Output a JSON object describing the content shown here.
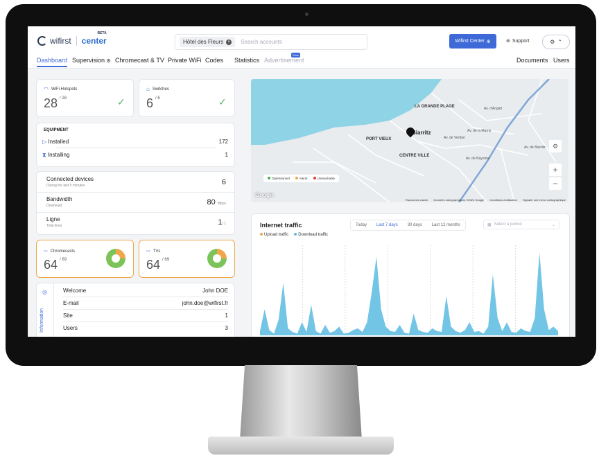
{
  "header": {
    "logo_brand": "wifirst",
    "logo_product": "center",
    "logo_beta": "BETA",
    "search_chip": "Hôtel des Fleurs",
    "search_placeholder": "Search accounts",
    "wifirst_center_button": "Wifirst Center",
    "support_label": "Support"
  },
  "nav": {
    "dashboard": "Dashboard",
    "supervision": "Supervision",
    "chromecast_tv": "Chromecast & TV",
    "private_wifi": "Private WiFi",
    "codes": "Codes",
    "statistics": "Statistics",
    "advertisement": "Advertisement",
    "soon_badge": "Soon",
    "documents": "Documents",
    "users": "Users"
  },
  "cards": {
    "wifi_hotspots": {
      "label": "WiFi Hotspots",
      "value": "28",
      "total": "/ 28"
    },
    "switches": {
      "label": "Switches",
      "value": "6",
      "total": "/ 6"
    },
    "equipment": {
      "title": "EQUIPMENT",
      "installed_label": "Installed",
      "installed_value": "172",
      "installing_label": "Installing",
      "installing_value": "1"
    },
    "connected_devices": {
      "label": "Connected devices",
      "sub": "During the last 5 minutes",
      "value": "6"
    },
    "bandwidth": {
      "label": "Bandwidth",
      "sub": "Download",
      "value": "80",
      "unit": "Mbps"
    },
    "ligne": {
      "label": "Ligne",
      "sub": "Total lines",
      "value": "1",
      "total": "/ 1"
    },
    "chromecasts": {
      "label": "Chromecasts",
      "value": "64",
      "total": "/ 69"
    },
    "tvs": {
      "label": "TVs",
      "value": "64",
      "total": "/ 69"
    },
    "information": {
      "side_label": "Information",
      "rows": [
        {
          "label": "Welcome",
          "value": "John DOE"
        },
        {
          "label": "E-mail",
          "value": "john.doe@wifirst.fr"
        },
        {
          "label": "Site",
          "value": "1"
        },
        {
          "label": "Users",
          "value": "3"
        }
      ]
    }
  },
  "map": {
    "labels": [
      "LA GRANDE PLAGE",
      "PORT VIEUX",
      "CENTRE VILLE",
      "Biarritz",
      "Av. d'Anglet",
      "Av. de la Marne",
      "Av. de Verdun",
      "Av. de Bayonne",
      "Av. de Biarritz"
    ],
    "legend": [
      "Opérationnel",
      "Alerte",
      "Unreachable"
    ],
    "legend_colors": [
      "#4caf50",
      "#f0a64b",
      "#e53935"
    ],
    "google": "Google",
    "footer": [
      "Raccourcis clavier",
      "Données cartographiques ©2024 Google",
      "Conditions d'utilisation",
      "Signaler une erreur cartographique"
    ]
  },
  "traffic": {
    "title": "Internet traffic",
    "ranges": [
      "Today",
      "Last 7 days",
      "30 days",
      "Last 12 months"
    ],
    "period_placeholder": "Select a period",
    "upload_label": "Upload traffic",
    "download_label": "Download traffic",
    "upload_color": "#f0a64b",
    "download_color": "#5bbbe0",
    "download_values": [
      0.05,
      0.3,
      0.06,
      0.02,
      0.18,
      0.6,
      0.08,
      0.04,
      0.02,
      0.15,
      0.04,
      0.35,
      0.05,
      0.02,
      0.12,
      0.03,
      0.05,
      0.1,
      0.02,
      0.03,
      0.06,
      0.08,
      0.04,
      0.15,
      0.5,
      0.9,
      0.3,
      0.1,
      0.05,
      0.04,
      0.12,
      0.03,
      0.02,
      0.25,
      0.06,
      0.04,
      0.03,
      0.08,
      0.05,
      0.04,
      0.45,
      0.1,
      0.05,
      0.03,
      0.06,
      0.15,
      0.04,
      0.05,
      0.02,
      0.1,
      0.7,
      0.2,
      0.05,
      0.15,
      0.04,
      0.03,
      0.08,
      0.05,
      0.04,
      0.2,
      0.95,
      0.3,
      0.06,
      0.1,
      0.05
    ]
  }
}
